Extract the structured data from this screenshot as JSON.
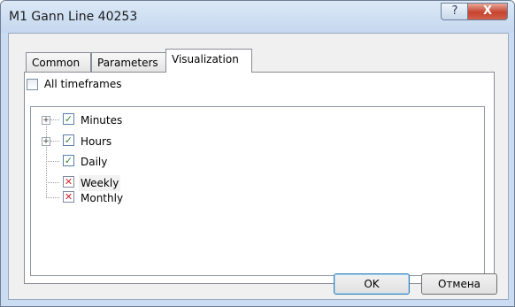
{
  "window": {
    "title": "M1 Gann Line 40253",
    "help_label": "?",
    "close_label": "X"
  },
  "tabs": [
    {
      "label": "Common"
    },
    {
      "label": "Parameters"
    },
    {
      "label": "Visualization"
    }
  ],
  "all_timeframes": {
    "label": "All timeframes",
    "checked": false
  },
  "tree": [
    {
      "label": "Minutes",
      "state": "checked",
      "expandable": true
    },
    {
      "label": "Hours",
      "state": "checked",
      "expandable": true
    },
    {
      "label": "Daily",
      "state": "checked",
      "expandable": false
    },
    {
      "label": "Weekly",
      "state": "unchecked",
      "expandable": false
    },
    {
      "label": "Monthly",
      "state": "unchecked",
      "expandable": false
    }
  ],
  "buttons": {
    "ok": "OK",
    "cancel": "Отмена"
  }
}
